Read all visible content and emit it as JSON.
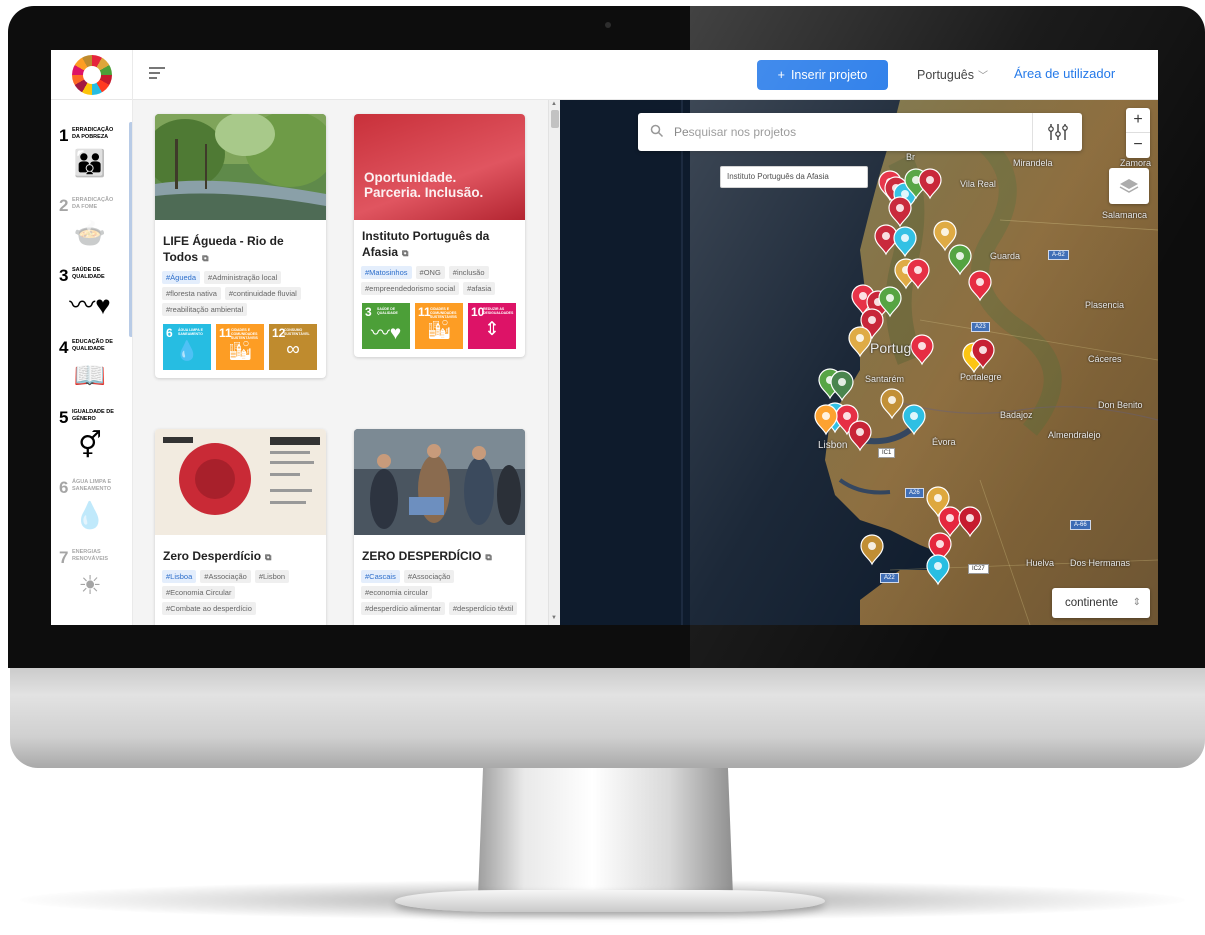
{
  "header": {
    "insert_button": "Inserir projeto",
    "language": "Português",
    "user_area": "Área de utilizador"
  },
  "sidebar": {
    "items": [
      {
        "num": "1",
        "label": "Erradicação da pobreza",
        "color": "#e5243b",
        "icon": "people-icon",
        "glyph": "👪"
      },
      {
        "num": "2",
        "label": "Erradicação da fome",
        "color": "#dda63a",
        "icon": "bowl-icon",
        "glyph": "🍲"
      },
      {
        "num": "3",
        "label": "Saúde de qualidade",
        "color": "#4c9f38",
        "icon": "heartbeat-icon",
        "glyph": "〰♥"
      },
      {
        "num": "4",
        "label": "Educação de qualidade",
        "color": "#c5192d",
        "icon": "book-icon",
        "glyph": "📖"
      },
      {
        "num": "5",
        "label": "Igualdade de género",
        "color": "#ff3a21",
        "icon": "gender-icon",
        "glyph": "⚥"
      },
      {
        "num": "6",
        "label": "Água limpa e saneamento",
        "color": "#26bde2",
        "icon": "water-icon",
        "glyph": "💧"
      },
      {
        "num": "7",
        "label": "Energias renováveis",
        "color": "#fcc30b",
        "icon": "sun-icon",
        "glyph": "☀"
      }
    ]
  },
  "cards": [
    {
      "title": "LIFE Águeda - Rio de Todos",
      "tags": [
        "#Águeda",
        "#Administração local",
        "#floresta nativa",
        "#continuidade fluvial",
        "#reabilitação ambiental"
      ],
      "sdgs": [
        {
          "num": "6",
          "label": "Água limpa e saneamento",
          "color": "#26bde2",
          "glyph": "💧"
        },
        {
          "num": "11",
          "label": "Cidades e comunidades sustentáveis",
          "color": "#fd9d24",
          "glyph": "🏙"
        },
        {
          "num": "12",
          "label": "Consumo sustentável",
          "color": "#bf8b2e",
          "glyph": "∞"
        }
      ]
    },
    {
      "title": "Instituto Português da Afasia",
      "image_text": "Oportunidade. Parceria. Inclusão.",
      "tags": [
        "#Matosinhos",
        "#ONG",
        "#inclusão",
        "#empreendedorismo social",
        "#afasia"
      ],
      "sdgs": [
        {
          "num": "3",
          "label": "Saúde de qualidade",
          "color": "#4c9f38",
          "glyph": "〰♥"
        },
        {
          "num": "11",
          "label": "Cidades e comunidades sustentáveis",
          "color": "#fd9d24",
          "glyph": "🏙"
        },
        {
          "num": "10",
          "label": "Reduzir as desigualdades",
          "color": "#dd1367",
          "glyph": "⇕"
        }
      ]
    },
    {
      "title": "Zero Desperdício",
      "tags": [
        "#Lisboa",
        "#Associação",
        "#Lisbon",
        "#Economia Circular",
        "#Combate ao desperdício"
      ]
    },
    {
      "title": "ZERO DESPERDÍCIO",
      "tags": [
        "#Cascais",
        "#Associação",
        "#economia circular",
        "#desperdício alimentar",
        "#desperdício têxtil"
      ]
    }
  ],
  "map": {
    "search_placeholder": "Pesquisar nos projetos",
    "tooltip": "Instituto Português da Afasia",
    "region_select": "continente",
    "zoom_in": "+",
    "zoom_out": "−",
    "labels": {
      "portugal": "Portug",
      "lisbon": "Lisbon",
      "santarem": "Santarém",
      "evora": "Évora",
      "portalegre": "Portalegre",
      "caceres": "Cáceres",
      "badajoz": "Badajoz",
      "guarda": "Guarda",
      "mirandela": "Mirandela",
      "zamora": "Zamora",
      "salamanca": "Salamanca",
      "vila_real": "Vila Real",
      "plasencia": "Plasencia",
      "don_benito": "Don Benito",
      "almendralejo": "Almendralejo",
      "huelva": "Huelva",
      "dos_hermanas": "Dos Hermanas",
      "br": "Br"
    },
    "roads": [
      "A-62",
      "A23",
      "IC1",
      "A26",
      "A-66",
      "IC27",
      "A22"
    ]
  }
}
